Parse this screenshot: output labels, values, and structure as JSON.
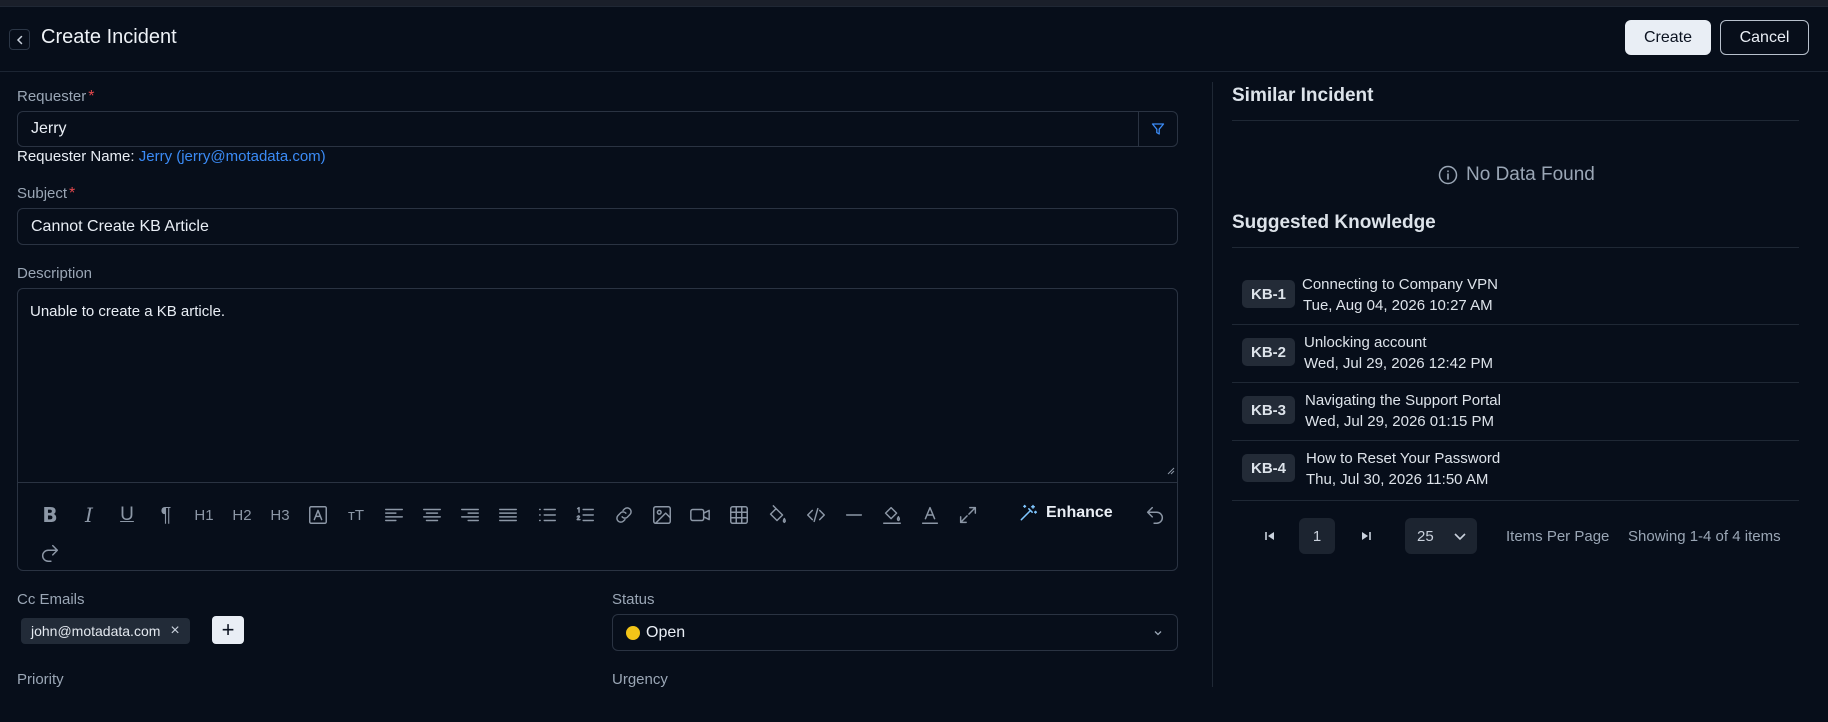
{
  "header": {
    "title": "Create Incident",
    "create_label": "Create",
    "cancel_label": "Cancel"
  },
  "form": {
    "requester": {
      "label": "Requester",
      "required_mark": "*",
      "value": "Jerry",
      "name_prefix": "Requester Name:",
      "name_link": "Jerry (jerry@motadata.com)"
    },
    "subject": {
      "label": "Subject",
      "required_mark": "*",
      "value": "Cannot Create KB Article"
    },
    "description": {
      "label": "Description",
      "value": "Unable to create a KB article.",
      "enhance_label": "Enhance",
      "toolbar_text_icons": {
        "h1": "H1",
        "h2": "H2",
        "h3": "H3",
        "text_size": "тT"
      }
    },
    "cc_emails": {
      "label": "Cc Emails",
      "chips": [
        "john@motadata.com"
      ]
    },
    "status": {
      "label": "Status",
      "value": "Open",
      "dot_color": "#f2c418"
    },
    "priority": {
      "label": "Priority"
    },
    "urgency": {
      "label": "Urgency"
    }
  },
  "similar_incident": {
    "title": "Similar Incident",
    "empty_text": "No Data Found"
  },
  "suggested_knowledge": {
    "title": "Suggested Knowledge",
    "items": [
      {
        "id": "KB-1",
        "title": "Connecting to Company VPN",
        "date": "Tue, Aug 04, 2026 10:27 AM"
      },
      {
        "id": "KB-2",
        "title": "Unlocking account",
        "date": "Wed, Jul 29, 2026 12:42 PM"
      },
      {
        "id": "KB-3",
        "title": "Navigating the Support Portal",
        "date": "Wed, Jul 29, 2026 01:15 PM"
      },
      {
        "id": "KB-4",
        "title": "How to Reset Your Password",
        "date": "Thu, Jul 30, 2026 11:50 AM"
      }
    ],
    "pagination": {
      "current_page": "1",
      "per_page": "25",
      "per_page_label": "Items Per Page",
      "showing_text": "Showing 1-4 of 4 items"
    }
  },
  "colors": {
    "background": "#070e1a",
    "accent_link": "#3b8bf6",
    "required": "#e5484d"
  }
}
